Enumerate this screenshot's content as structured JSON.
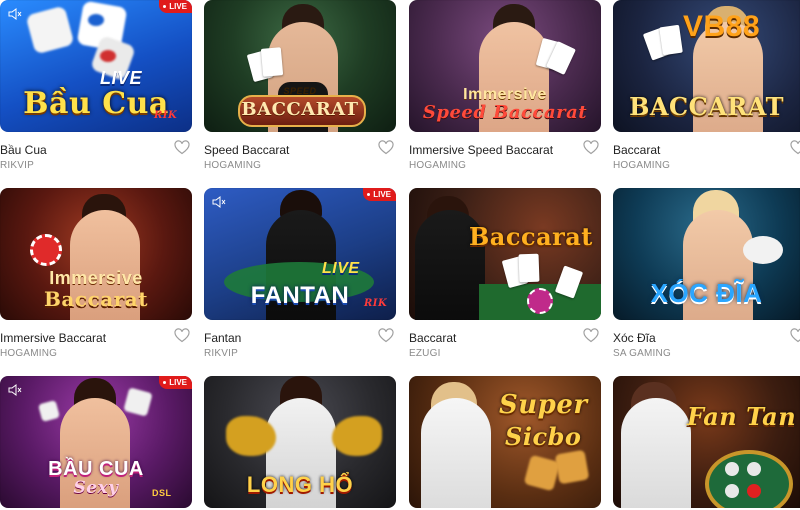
{
  "games": [
    {
      "name": "Bầu Cua",
      "provider": "RIKVIP",
      "art_title": "Bầu Cua",
      "art_sub": "LIVE",
      "art_brand": "RIK",
      "live": "LIVE",
      "bg": "#1a5fd6"
    },
    {
      "name": "Speed Baccarat",
      "provider": "HOGAMING",
      "art_title": "BACCARAT",
      "art_sub": "SPEED",
      "bg": "#1e3b22"
    },
    {
      "name": "Immersive Speed Baccarat",
      "provider": "HOGAMING",
      "art_title": "Immersive",
      "art_sub": "Speed Baccarat",
      "bg": "#4a2a4e"
    },
    {
      "name": "Baccarat",
      "provider": "HOGAMING",
      "art_title": "BACCARAT",
      "art_brand": "VB88",
      "bg": "#1b2440"
    },
    {
      "name": "Immersive Baccarat",
      "provider": "HOGAMING",
      "art_title": "Immersive",
      "art_sub": "Baccarat",
      "bg": "#5a1810"
    },
    {
      "name": "Fantan",
      "provider": "RIKVIP",
      "art_title": "FANTAN",
      "art_sub": "LIVE",
      "art_brand": "RIK",
      "live": "LIVE",
      "bg": "#1c3e86"
    },
    {
      "name": "Baccarat",
      "provider": "EZUGI",
      "art_title": "Baccarat",
      "bg": "#3a1f16"
    },
    {
      "name": "Xóc Đĩa",
      "provider": "SA GAMING",
      "art_title": "XÓC ĐĨA",
      "bg": "#0e3b55"
    },
    {
      "name": "Bầu Cua Sexy",
      "provider": "",
      "art_title": "BẦU CUA",
      "art_sub": "Sexy",
      "art_brand": "DSL",
      "live": "LIVE",
      "bg": "#5a1a66"
    },
    {
      "name": "Long Hổ",
      "provider": "",
      "art_title": "LONG HỔ",
      "bg": "#2a2a2e"
    },
    {
      "name": "Super Sicbo",
      "provider": "",
      "art_title": "Super",
      "art_sub": "Sicbo",
      "bg": "#5a2e12"
    },
    {
      "name": "Fan Tan",
      "provider": "",
      "art_title": "Fan Tan",
      "bg": "#3c1d10"
    }
  ]
}
